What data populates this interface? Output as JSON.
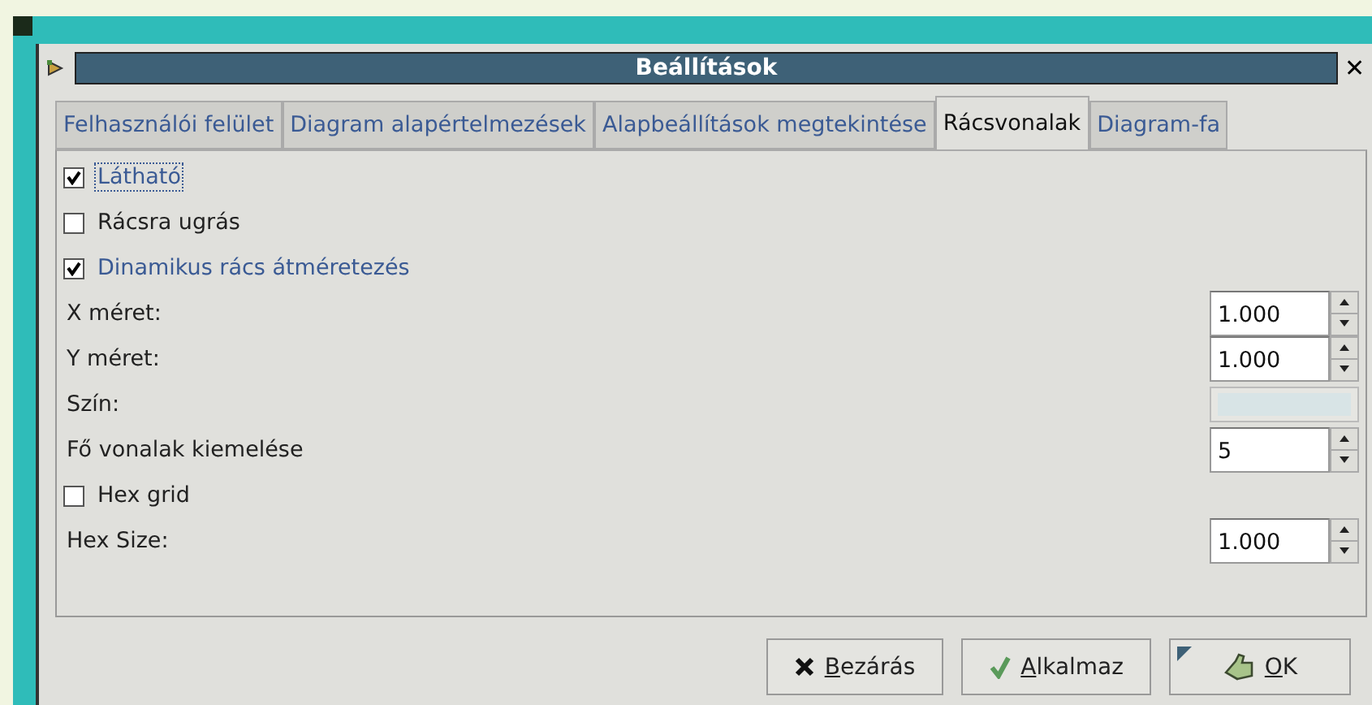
{
  "window": {
    "title": "Beállítások",
    "close": "✕"
  },
  "tabs": [
    {
      "label": "Felhasználói felület",
      "selected": false
    },
    {
      "label": "Diagram alapértelmezések",
      "selected": false
    },
    {
      "label": "Alapbeállítások megtekintése",
      "selected": false
    },
    {
      "label": "Rácsvonalak",
      "selected": true
    },
    {
      "label": "Diagram-fa",
      "selected": false
    }
  ],
  "rows": [
    {
      "kind": "checkbox",
      "label": "Látható",
      "checked": true,
      "focused": true
    },
    {
      "kind": "checkbox",
      "label": "Rácsra ugrás",
      "checked": false,
      "focused": false
    },
    {
      "kind": "checkbox",
      "label": "Dinamikus rács átméretezés",
      "checked": true,
      "focused": false
    },
    {
      "kind": "spin",
      "label": "X méret:",
      "value": "1.000"
    },
    {
      "kind": "spin",
      "label": "Y méret:",
      "value": "1.000"
    },
    {
      "kind": "color",
      "label": "Szín:",
      "color": "#d8e4e6"
    },
    {
      "kind": "spin",
      "label": "Fő vonalak kiemelése",
      "value": "5"
    },
    {
      "kind": "checkbox",
      "label": "Hex grid",
      "checked": false,
      "focused": false
    },
    {
      "kind": "spin",
      "label": "Hex Size:",
      "value": "1.000"
    }
  ],
  "buttons": [
    {
      "kind": "close",
      "label": "Bezárás"
    },
    {
      "kind": "apply",
      "label": "Alkalmaz"
    },
    {
      "kind": "ok",
      "label": "OK"
    }
  ]
}
